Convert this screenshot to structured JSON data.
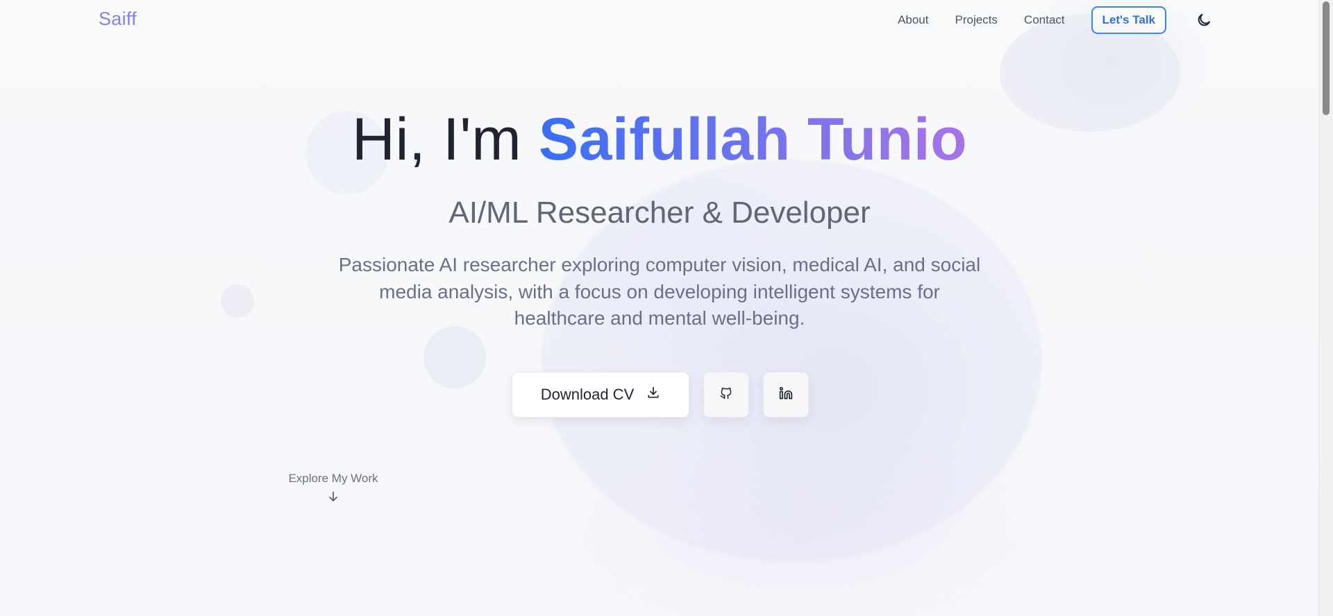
{
  "nav": {
    "logo": "Saiff",
    "links": [
      "About",
      "Projects",
      "Contact"
    ],
    "cta_label": "Let's Talk",
    "theme_toggle_icon": "moon-icon"
  },
  "hero": {
    "greeting": "Hi, I'm ",
    "name": "Saifullah Tunio",
    "subtitle": "AI/ML Researcher & Developer",
    "description": "Passionate AI researcher exploring computer vision, medical AI, and social media analysis, with a focus on developing intelligent systems for healthcare and mental well-being."
  },
  "actions": {
    "download_cv_label": "Download CV",
    "download_icon": "download-icon",
    "github_icon": "github-icon",
    "linkedin_icon": "linkedin-icon"
  },
  "explore": {
    "label": "Explore My Work",
    "icon": "arrow-down-icon"
  },
  "colors": {
    "accent_blue": "#3b82f6",
    "gradient_start": "#3b6ef2",
    "gradient_end": "#a874e6",
    "logo": "#8b7fe8"
  }
}
